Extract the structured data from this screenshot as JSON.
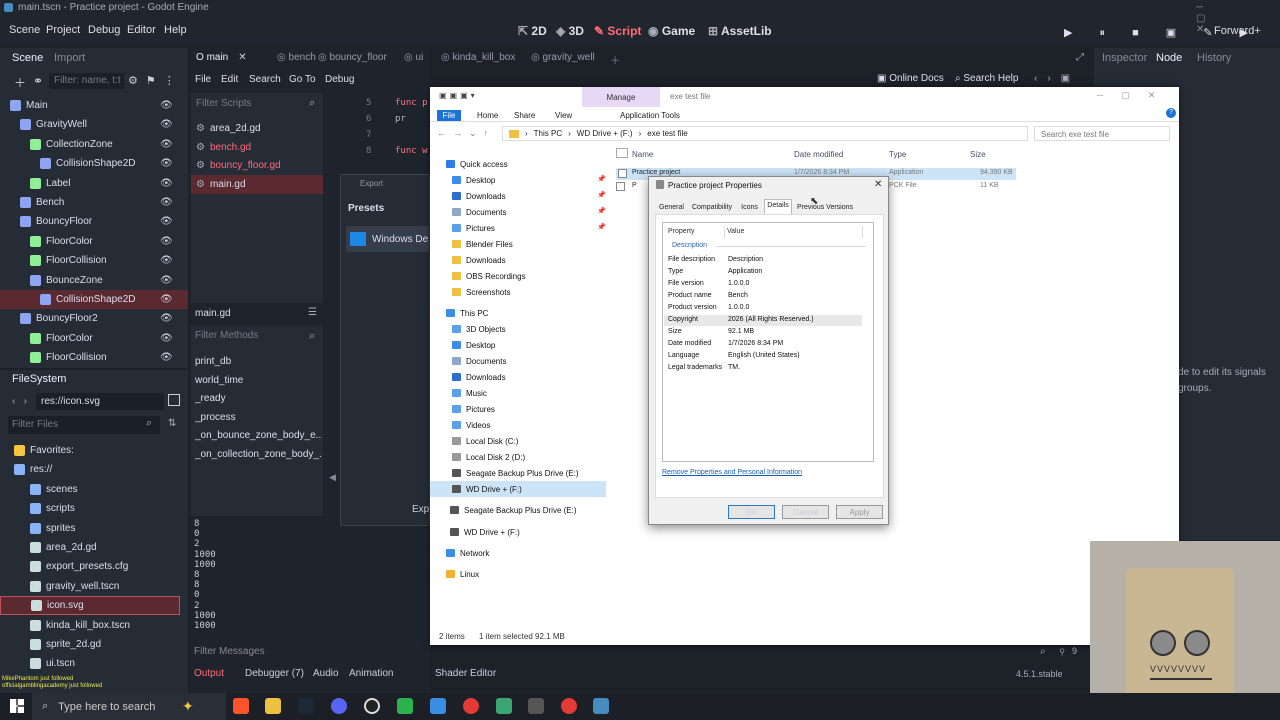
{
  "window": {
    "title": "main.tscn - Practice project - Godot Engine"
  },
  "menu": [
    "Scene",
    "Project",
    "Debug",
    "Editor",
    "Help"
  ],
  "modes": [
    "2D",
    "3D",
    "Script",
    "Game",
    "AssetLib"
  ],
  "renderer": "Forward+",
  "dock_tabs": {
    "scene": "Scene",
    "import": "Import",
    "filter": "Filter: name, t:t",
    "inspector": "Inspector",
    "node": "Node",
    "history": "History"
  },
  "scene_tree": [
    {
      "label": "Main",
      "indent": 0,
      "color": "#8da5f3"
    },
    {
      "label": "GravityWell",
      "indent": 1,
      "color": "#8da5f3"
    },
    {
      "label": "CollectionZone",
      "indent": 2,
      "color": "#8eef97"
    },
    {
      "label": "CollisionShape2D",
      "indent": 3,
      "color": "#8da5f3"
    },
    {
      "label": "Label",
      "indent": 2,
      "color": "#8eef97"
    },
    {
      "label": "Bench",
      "indent": 1,
      "color": "#8da5f3"
    },
    {
      "label": "BouncyFloor",
      "indent": 1,
      "color": "#8da5f3"
    },
    {
      "label": "FloorColor",
      "indent": 2,
      "color": "#8eef97"
    },
    {
      "label": "FloorCollision",
      "indent": 2,
      "color": "#8eef97"
    },
    {
      "label": "BounceZone",
      "indent": 2,
      "color": "#8da5f3"
    },
    {
      "label": "CollisionShape2D",
      "indent": 3,
      "color": "#8da5f3"
    },
    {
      "label": "BouncyFloor2",
      "indent": 1,
      "color": "#8da5f3"
    },
    {
      "label": "FloorColor",
      "indent": 2,
      "color": "#8eef97"
    },
    {
      "label": "FloorCollision",
      "indent": 2,
      "color": "#8eef97"
    }
  ],
  "filesystem": {
    "title": "FileSystem",
    "path": "res://icon.svg",
    "filter": "Filter Files",
    "items": [
      "Favorites:",
      "res://",
      "scenes",
      "scripts",
      "sprites",
      "area_2d.gd",
      "export_presets.cfg",
      "gravity_well.tscn",
      "icon.svg",
      "kinda_kill_box.tscn",
      "sprite_2d.gd",
      "ui.tscn"
    ]
  },
  "script_menu": [
    "File",
    "Edit",
    "Search",
    "Go To",
    "Debug"
  ],
  "editor_tabs": [
    "main",
    "bench",
    "bouncy_floor",
    "ui",
    "kinda_kill_box",
    "gravity_well"
  ],
  "scripts": {
    "filter": "Filter Scripts",
    "items": [
      "area_2d.gd",
      "bench.gd",
      "bouncy_floor.gd",
      "main.gd"
    ],
    "current": "main.gd"
  },
  "methods": {
    "filter": "Filter Methods",
    "items": [
      "print_db",
      "world_time",
      "_ready",
      "_process",
      "_on_bounce_zone_body_e...",
      "_on_collection_zone_body_..."
    ]
  },
  "code": {
    "lines": [
      "5",
      "6",
      "7",
      "8"
    ],
    "text": [
      "func p",
      "pr",
      "",
      "func w"
    ]
  },
  "right_header": {
    "online_docs": "Online Docs",
    "search_help": "Search Help"
  },
  "node_hint": [
    "de to edit its signals",
    "groups."
  ],
  "export": {
    "title": "Export",
    "presets": "Presets",
    "preset_item": "Windows De",
    "button": "Exp"
  },
  "output": {
    "numbers": [
      "8",
      "0",
      "2",
      "1000",
      "1000",
      "8",
      "8",
      "0",
      "2",
      "1000",
      "1000"
    ],
    "filter": "Filter Messages"
  },
  "bottom_tabs": [
    "Output",
    "Debugger (7)",
    "Audio",
    "Animation",
    "Shader Editor"
  ],
  "version": "4.5.1.stable",
  "explorer": {
    "ribbon": {
      "manage": "Manage",
      "title": "exe test file",
      "tabs": [
        "File",
        "Home",
        "Share",
        "View",
        "Application Tools"
      ]
    },
    "breadcrumb": [
      "This PC",
      "WD Drive + (F:)",
      "exe test file"
    ],
    "search": "Search exe test file",
    "columns": [
      "Name",
      "Date modified",
      "Type",
      "Size"
    ],
    "files": [
      {
        "name": "Practice project",
        "date": "1/7/2026 8:34 PM",
        "type": "Application",
        "size": "94,390 KB"
      },
      {
        "name": "P",
        "date": "",
        "type": "PCK File",
        "size": "11 KB"
      }
    ],
    "nav": [
      {
        "label": "Quick access",
        "color": "#2d7be5",
        "indent": 0
      },
      {
        "label": "Desktop",
        "color": "#3b8be8",
        "indent": 1
      },
      {
        "label": "Downloads",
        "color": "#2c6fd1",
        "indent": 1
      },
      {
        "label": "Documents",
        "color": "#8fa8c8",
        "indent": 1
      },
      {
        "label": "Pictures",
        "color": "#5aa0e8",
        "indent": 1
      },
      {
        "label": "Blender Files",
        "color": "#f0c040",
        "indent": 1
      },
      {
        "label": "Downloads",
        "color": "#f0c040",
        "indent": 1
      },
      {
        "label": "OBS Recordings",
        "color": "#f0c040",
        "indent": 1
      },
      {
        "label": "Screenshots",
        "color": "#f0c040",
        "indent": 1
      },
      {
        "label": "This PC",
        "color": "#3a8ee6",
        "indent": 0
      },
      {
        "label": "3D Objects",
        "color": "#5aa0e8",
        "indent": 1
      },
      {
        "label": "Desktop",
        "color": "#3b8be8",
        "indent": 1
      },
      {
        "label": "Documents",
        "color": "#8fa8c8",
        "indent": 1
      },
      {
        "label": "Downloads",
        "color": "#2c6fd1",
        "indent": 1
      },
      {
        "label": "Music",
        "color": "#5aa0e8",
        "indent": 1
      },
      {
        "label": "Pictures",
        "color": "#5aa0e8",
        "indent": 1
      },
      {
        "label": "Videos",
        "color": "#5aa0e8",
        "indent": 1
      },
      {
        "label": "Local Disk (C:)",
        "color": "#999999",
        "indent": 1
      },
      {
        "label": "Local Disk 2 (D:)",
        "color": "#999999",
        "indent": 1
      },
      {
        "label": "Seagate Backup Plus Drive (E:)",
        "color": "#555555",
        "indent": 1
      },
      {
        "label": "WD Drive + (F:)",
        "color": "#555555",
        "indent": 1
      },
      {
        "label": "Seagate Backup Plus Drive (E:)",
        "color": "#555555",
        "indent": 0
      },
      {
        "label": "WD Drive + (F:)",
        "color": "#555555",
        "indent": 0
      },
      {
        "label": "Network",
        "color": "#3a8ee6",
        "indent": 0
      },
      {
        "label": "Linux",
        "color": "#f0b030",
        "indent": 0
      }
    ],
    "status": {
      "count": "2 items",
      "selected": "1 item selected  92.1 MB"
    }
  },
  "dialog": {
    "title": "Practice project Properties",
    "tabs": [
      "General",
      "Compatibility",
      "Icons",
      "Details",
      "Previous Versions"
    ],
    "headers": {
      "property": "Property",
      "value": "Value",
      "section": "Description"
    },
    "props": [
      [
        "File description",
        "Description"
      ],
      [
        "Type",
        "Application"
      ],
      [
        "File version",
        "1.0.0.0"
      ],
      [
        "Product name",
        "Bench"
      ],
      [
        "Product version",
        "1.0.0.0"
      ],
      [
        "Copyright",
        "2026 (All Rights Reserved.)"
      ],
      [
        "Size",
        "92.1 MB"
      ],
      [
        "Date modified",
        "1/7/2026 8:34 PM"
      ],
      [
        "Language",
        "English (United States)"
      ],
      [
        "Legal trademarks",
        "TM."
      ]
    ],
    "link": "Remove Properties and Personal Information",
    "buttons": {
      "ok": "OK",
      "cancel": "Cancel",
      "apply": "Apply"
    }
  },
  "taskbar": {
    "search": "Type here to search"
  },
  "chat": [
    "MikePhantom just followed",
    "officialgamblingacademy just followed"
  ]
}
